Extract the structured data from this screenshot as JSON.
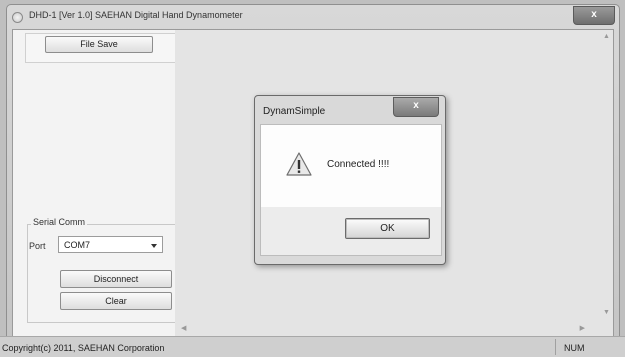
{
  "window": {
    "title": "DHD-1 [Ver 1.0] SAEHAN Digital Hand Dynamometer",
    "close_label": "x"
  },
  "left_panel": {
    "file_save_label": "File Save",
    "serial_group_label": "Serial Comm",
    "port_label": "Port",
    "port_value": "COM7",
    "disconnect_label": "Disconnect",
    "clear_label": "Clear"
  },
  "dialog": {
    "title": "DynamSimple",
    "close_label": "x",
    "message": "Connected !!!!",
    "ok_label": "OK",
    "icon": "warning-icon"
  },
  "statusbar": {
    "copyright": "Copyright(c) 2011, SAEHAN Corporation",
    "num": "NUM"
  },
  "colors": {
    "window_bg": "#d0d0d0",
    "client_bg": "#e4e4e4",
    "warning_fill": "#f2c94c"
  }
}
